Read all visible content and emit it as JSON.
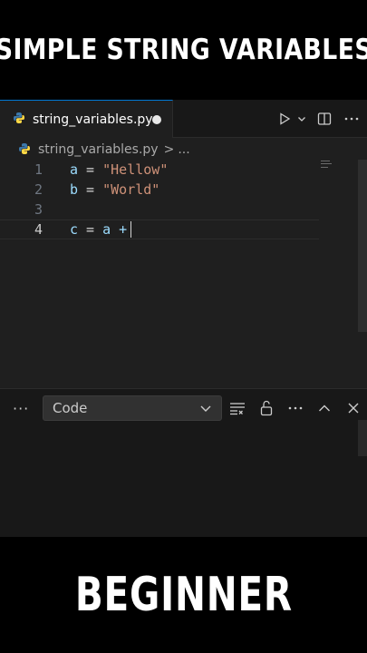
{
  "header_banner": {
    "text": "SIMPLE STRING VARIABLES"
  },
  "footer_banner": {
    "text": "BEGINNER"
  },
  "editor": {
    "tab": {
      "label": "string_variables.py",
      "unsaved": true
    },
    "breadcrumb": {
      "file": "string_variables.py",
      "separator": ">",
      "more": "..."
    },
    "lines": [
      {
        "number": "1",
        "var": "a",
        "op": " = ",
        "value": "\"Hellow\""
      },
      {
        "number": "2",
        "var": "b",
        "op": " = ",
        "value": "\"World\""
      },
      {
        "number": "3",
        "var": "",
        "op": "",
        "value": ""
      },
      {
        "number": "4",
        "var": "c",
        "op": " = ",
        "value": "a +"
      }
    ],
    "active_line": "4"
  },
  "panel": {
    "dropdown_value": "Code",
    "more_label": "···"
  },
  "colors": {
    "editor_bg": "#1f1f1f",
    "string": "#ce9178",
    "variable": "#9cdcfe",
    "accent": "#0078d4",
    "python_blue": "#3c78aa",
    "python_yellow": "#ffd845"
  },
  "icons": [
    "python-file-icon",
    "run-icon",
    "chevron-down-icon",
    "split-editor-icon",
    "more-actions-icon",
    "word-wrap-icon",
    "unlock-icon",
    "chevron-up-icon",
    "close-icon"
  ]
}
